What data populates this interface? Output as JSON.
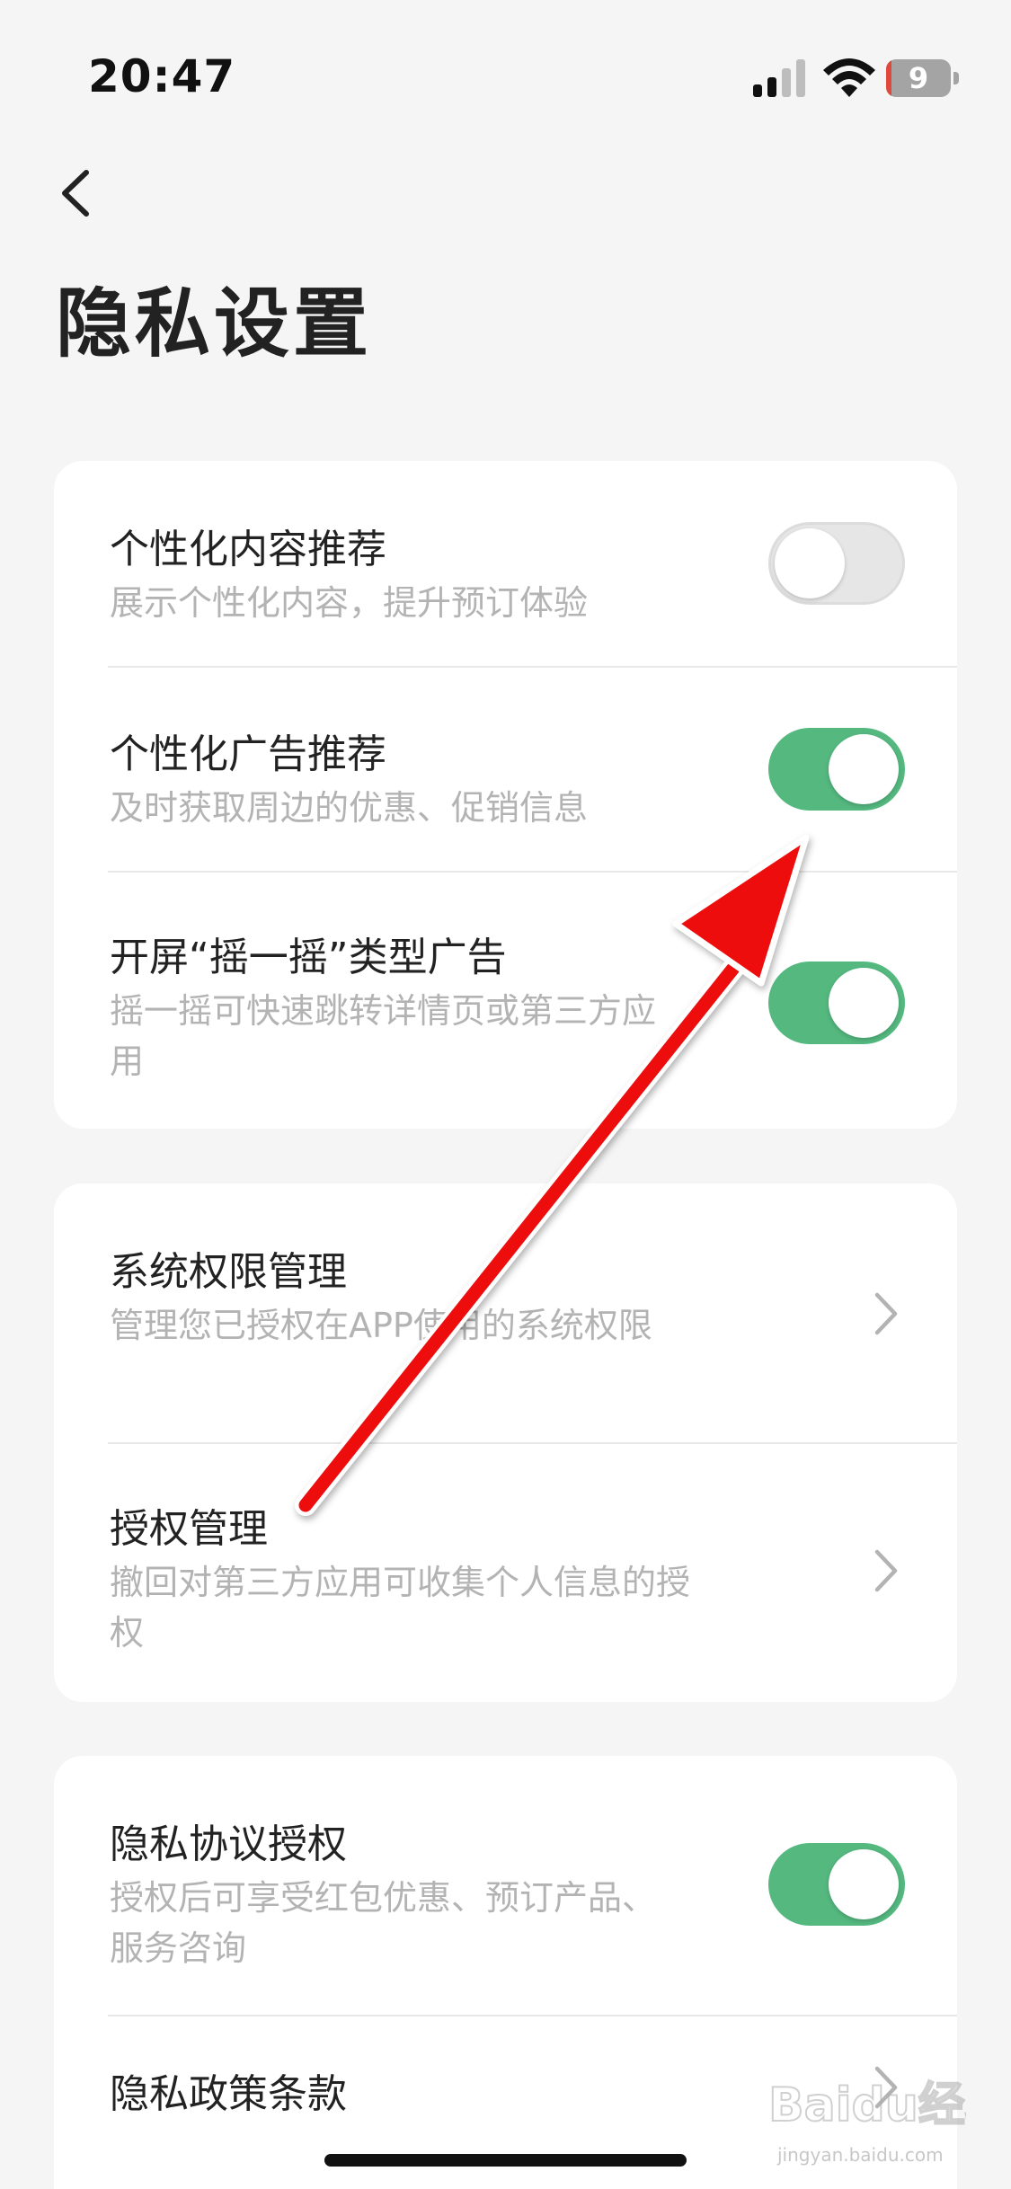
{
  "status_bar": {
    "time": "20:47",
    "battery_level": "9",
    "icons": [
      "signal-icon",
      "wifi-icon",
      "battery-icon"
    ]
  },
  "header": {
    "back_icon": "chevron-left-icon",
    "title": "隐私设置"
  },
  "cards": [
    {
      "rows": [
        {
          "title": "个性化内容推荐",
          "description": "展示个性化内容，提升预订体验",
          "control": "toggle",
          "on": false
        },
        {
          "title": "个性化广告推荐",
          "description": "及时获取周边的优惠、促销信息",
          "control": "toggle",
          "on": true
        },
        {
          "title": "开屏“摇一摇”类型广告",
          "description": "摇一摇可快速跳转详情页或第三方应用",
          "control": "toggle",
          "on": true
        }
      ]
    },
    {
      "rows": [
        {
          "title": "系统权限管理",
          "description": "管理您已授权在APP使用的系统权限",
          "control": "chevron"
        },
        {
          "title": "授权管理",
          "description": "撤回对第三方应用可收集个人信息的授权",
          "control": "chevron"
        }
      ]
    },
    {
      "rows": [
        {
          "title": "隐私协议授权",
          "description": "授权后可享受红包优惠、预订产品、服务咨询",
          "control": "toggle",
          "on": true
        },
        {
          "title": "隐私政策条款",
          "control": "chevron"
        }
      ]
    }
  ],
  "colors": {
    "background": "#f5f5f5",
    "card": "#ffffff",
    "toggle_on": "#54b87f",
    "toggle_off": "#e6e6e6",
    "title_text": "#222222",
    "description_text": "#b3b3b3",
    "annotation_arrow": "#ff0000"
  },
  "annotation": {
    "type": "arrow",
    "color": "#ff0000",
    "points_to": "个性化广告推荐 toggle"
  },
  "watermark": {
    "logo_text": "Baidu经验",
    "url_text": "jingyan.baidu.com"
  }
}
